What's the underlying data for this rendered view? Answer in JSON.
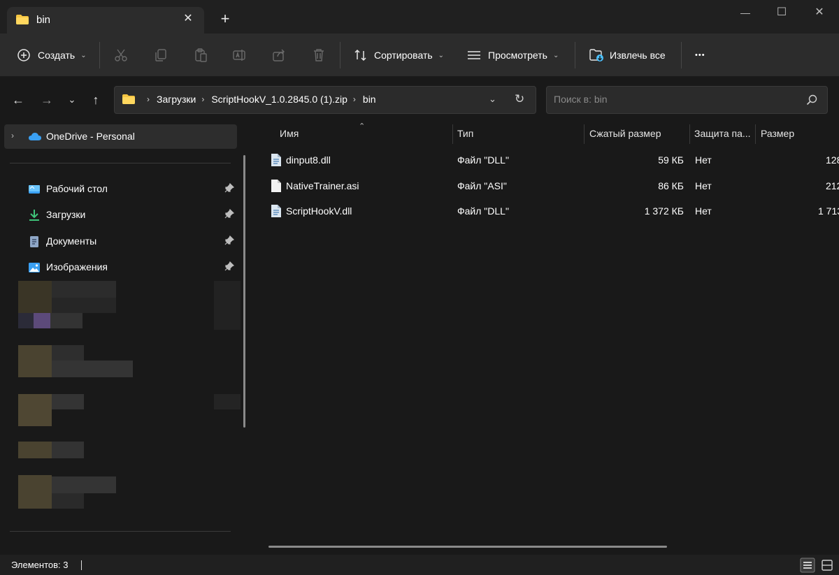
{
  "tab": {
    "title": "bin",
    "close": "✕",
    "new_tab": "+"
  },
  "window": {
    "minimize": "—",
    "maximize": "☐",
    "close": "✕"
  },
  "toolbar": {
    "create_label": "Создать",
    "sort_label": "Сортировать",
    "view_label": "Просмотреть",
    "extract_label": "Извлечь все",
    "more_label": "•••"
  },
  "address": {
    "crumbs": [
      "Загрузки",
      "ScriptHookV_1.0.2845.0 (1).zip",
      "bin"
    ],
    "search_placeholder": "Поиск в: bin"
  },
  "sidebar": {
    "onedrive": "OneDrive - Personal",
    "items": [
      {
        "label": "Рабочий стол",
        "icon": "desktop-icon"
      },
      {
        "label": "Загрузки",
        "icon": "downloads-icon"
      },
      {
        "label": "Документы",
        "icon": "documents-icon"
      },
      {
        "label": "Изображения",
        "icon": "pictures-icon"
      }
    ]
  },
  "columns": {
    "name": "Имя",
    "type": "Тип",
    "compressed": "Сжатый размер",
    "protection": "Защита па...",
    "size": "Размер"
  },
  "files": [
    {
      "name": "dinput8.dll",
      "type": "Файл \"DLL\"",
      "compressed": "59 КБ",
      "protection": "Нет",
      "size": "128",
      "icon": "dll-file-icon"
    },
    {
      "name": "NativeTrainer.asi",
      "type": "Файл \"ASI\"",
      "compressed": "86 КБ",
      "protection": "Нет",
      "size": "212",
      "icon": "file-icon"
    },
    {
      "name": "ScriptHookV.dll",
      "type": "Файл \"DLL\"",
      "compressed": "1 372 КБ",
      "protection": "Нет",
      "size": "1 713",
      "icon": "dll-file-icon"
    }
  ],
  "status": {
    "count": "Элементов: 3"
  },
  "colors": {
    "folder": "#f5c542",
    "accent": "#4cc2ff",
    "onedrive": "#3aa0f3"
  }
}
